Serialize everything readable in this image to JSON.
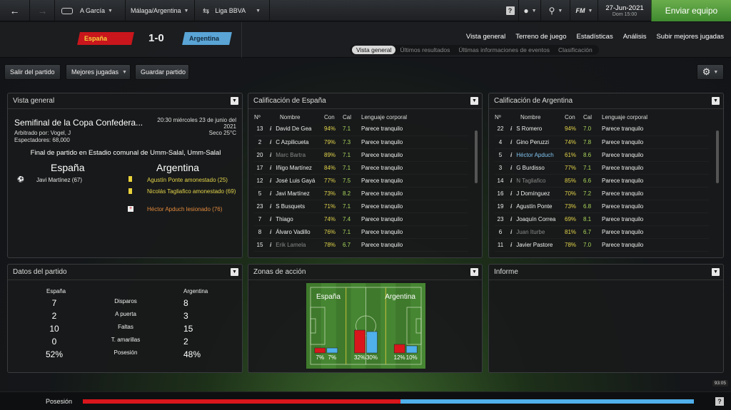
{
  "topbar": {
    "manager": "A García",
    "club": "Málaga/Argentina",
    "league": "Liga BBVA",
    "game_label": "FM",
    "date": "27-Jun-2021",
    "day_time": "Dom 15:00",
    "send_label": "Enviar equipo"
  },
  "header": {
    "home": "España",
    "away": "Argentina",
    "score": "1-0",
    "nav": [
      "Vista general",
      "Terreno de juego",
      "Estadísticas",
      "Análisis",
      "Subir mejores jugadas"
    ],
    "subtabs": [
      "Vista general",
      "Últimos resultados",
      "Últimas informaciones de eventos",
      "Clasificación"
    ]
  },
  "toolbar": {
    "exit": "Salir del partido",
    "highlights": "Mejores jugadas",
    "save": "Guardar partido"
  },
  "overview": {
    "title": "Vista general",
    "competition": "Semifinal de la Copa Confedera...",
    "datetime": "20:30 miércoles 23 de junio del 2021",
    "referee": "Arbitrado por: Vogel, J",
    "weather": "Seco 25°C",
    "spectators": "Espectadores: 68,000",
    "result": "Final de partido en Estadio comunal de Umm-Salal, Umm-Salal",
    "home": "España",
    "away": "Argentina",
    "home_events": [
      "Javi Martínez (67)"
    ],
    "away_events": [
      "Agustín Ponte amonestado (25)",
      "Nicolás Tagliafico amonestado (69)",
      "Héctor Apduch lesionado (76)"
    ]
  },
  "ratings_headers": {
    "n": "Nº",
    "name": "Nombre",
    "con": "Con",
    "cal": "Cal",
    "lang": "Lenguaje corporal"
  },
  "ratings_es": {
    "title": "Calificación de España",
    "rows": [
      {
        "n": "13",
        "name": "David De Gea",
        "con": "94%",
        "cal": "7.1",
        "lang": "Parece tranquilo",
        "dim": false
      },
      {
        "n": "2",
        "name": "C Azpilicueta",
        "con": "79%",
        "cal": "7.3",
        "lang": "Parece tranquilo",
        "dim": false
      },
      {
        "n": "20",
        "name": "Marc Bartra",
        "con": "89%",
        "cal": "7.1",
        "lang": "Parece tranquilo",
        "dim": true
      },
      {
        "n": "17",
        "name": "Iñigo Martínez",
        "con": "84%",
        "cal": "7.1",
        "lang": "Parece tranquilo",
        "dim": false
      },
      {
        "n": "12",
        "name": "José Luis Gayá",
        "con": "77%",
        "cal": "7.5",
        "lang": "Parece tranquilo",
        "dim": false
      },
      {
        "n": "5",
        "name": "Javi Martínez",
        "con": "73%",
        "cal": "8.2",
        "lang": "Parece tranquilo",
        "dim": false
      },
      {
        "n": "23",
        "name": "S Busquets",
        "con": "71%",
        "cal": "7.1",
        "lang": "Parece tranquilo",
        "dim": false
      },
      {
        "n": "7",
        "name": "Thiago",
        "con": "74%",
        "cal": "7.4",
        "lang": "Parece tranquilo",
        "dim": false
      },
      {
        "n": "8",
        "name": "Álvaro Vadillo",
        "con": "76%",
        "cal": "7.1",
        "lang": "Parece tranquilo",
        "dim": false
      },
      {
        "n": "15",
        "name": "Erik Lamela",
        "con": "78%",
        "cal": "6.7",
        "lang": "Parece tranquilo",
        "dim": true
      }
    ]
  },
  "ratings_ar": {
    "title": "Calificación de Argentina",
    "rows": [
      {
        "n": "22",
        "name": "S Romero",
        "con": "94%",
        "cal": "7.0",
        "lang": "Parece tranquilo",
        "dim": false
      },
      {
        "n": "4",
        "name": "Gino Peruzzi",
        "con": "74%",
        "cal": "7.8",
        "lang": "Parece tranquilo",
        "dim": false
      },
      {
        "n": "5",
        "name": "Héctor Apduch",
        "con": "61%",
        "cal": "8.6",
        "lang": "Parece tranquilo",
        "dim": false,
        "blue": true
      },
      {
        "n": "3",
        "name": "G Burdisso",
        "con": "77%",
        "cal": "7.1",
        "lang": "Parece tranquilo",
        "dim": false
      },
      {
        "n": "14",
        "name": "N Tagliafico",
        "con": "85%",
        "cal": "6.6",
        "lang": "Parece tranquilo",
        "dim": true
      },
      {
        "n": "16",
        "name": "J Domínguez",
        "con": "70%",
        "cal": "7.2",
        "lang": "Parece tranquilo",
        "dim": false
      },
      {
        "n": "19",
        "name": "Agustín Ponte",
        "con": "73%",
        "cal": "6.8",
        "lang": "Parece tranquilo",
        "dim": false
      },
      {
        "n": "23",
        "name": "Joaquín Correa",
        "con": "69%",
        "cal": "8.1",
        "lang": "Parece tranquilo",
        "dim": false
      },
      {
        "n": "6",
        "name": "Juan Iturbe",
        "con": "81%",
        "cal": "6.7",
        "lang": "Parece tranquilo",
        "dim": true
      },
      {
        "n": "11",
        "name": "Javier Pastore",
        "con": "78%",
        "cal": "7.0",
        "lang": "Parece tranquilo",
        "dim": false
      }
    ]
  },
  "match_stats": {
    "title": "Datos del partido",
    "home": "España",
    "away": "Argentina",
    "rows": [
      {
        "label": "Disparos",
        "home": "7",
        "away": "8"
      },
      {
        "label": "A puerta",
        "home": "2",
        "away": "3"
      },
      {
        "label": "Faltas",
        "home": "10",
        "away": "15"
      },
      {
        "label": "T. amarillas",
        "home": "0",
        "away": "2"
      },
      {
        "label": "Posesión",
        "home": "52%",
        "away": "48%"
      }
    ]
  },
  "action_zones": {
    "title": "Zonas de acción",
    "home": "España",
    "away": "Argentina",
    "zones": [
      {
        "home": 7,
        "away": 7,
        "home_label": "7%",
        "away_label": "7%"
      },
      {
        "home": 32,
        "away": 30,
        "home_label": "32%",
        "away_label": "30%"
      },
      {
        "home": 12,
        "away": 10,
        "home_label": "12%",
        "away_label": "10%"
      }
    ]
  },
  "report": {
    "title": "Informe"
  },
  "footer": {
    "label": "Posesión",
    "home_pct": 52,
    "clock": "93:05"
  },
  "colors": {
    "home": "#d9161c",
    "away": "#4fb0ec",
    "accent": "#5da443"
  }
}
